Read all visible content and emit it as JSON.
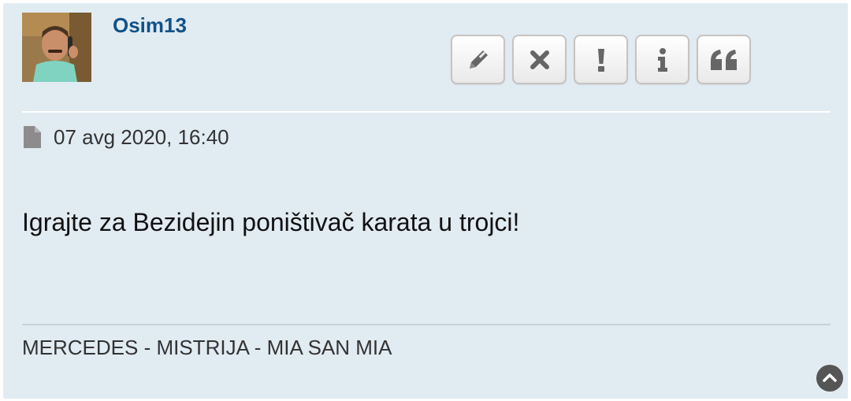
{
  "post": {
    "author": "Osim13",
    "date": "07 avg 2020, 16:40",
    "content": "Igrajte za Bezidejin poništivač karata u trojci!",
    "signature": "MERCEDES - MISTRIJA - MIA SAN MIA"
  },
  "actions": [
    {
      "name": "edit",
      "icon": "pencil-icon"
    },
    {
      "name": "delete",
      "icon": "close-icon"
    },
    {
      "name": "report",
      "icon": "exclamation-icon"
    },
    {
      "name": "info",
      "icon": "info-icon"
    },
    {
      "name": "quote",
      "icon": "quote-icon"
    }
  ],
  "icons": {
    "date": "document-icon",
    "back_to_top": "chevron-up-circle-icon"
  },
  "colors": {
    "post_background": "#e1ebf2",
    "username": "#105289",
    "text": "#333333"
  }
}
